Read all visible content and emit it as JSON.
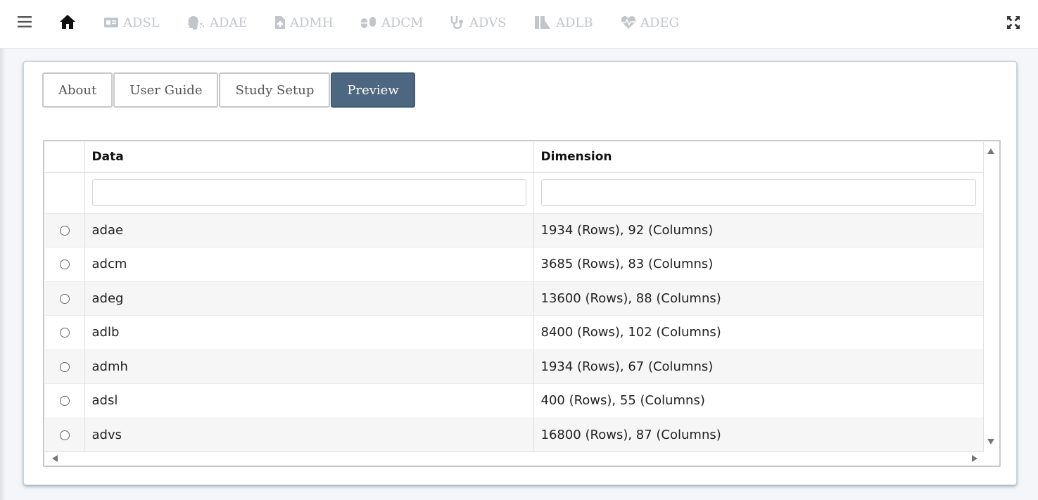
{
  "nav": {
    "items": [
      {
        "label": "ADSL",
        "icon": "id-card-icon"
      },
      {
        "label": "ADAE",
        "icon": "head-virus-icon"
      },
      {
        "label": "ADMH",
        "icon": "file-medical-icon"
      },
      {
        "label": "ADCM",
        "icon": "pills-icon"
      },
      {
        "label": "ADVS",
        "icon": "stethoscope-icon"
      },
      {
        "label": "ADLB",
        "icon": "flask-icon"
      },
      {
        "label": "ADEG",
        "icon": "heart-pulse-icon"
      }
    ]
  },
  "tabs": [
    {
      "label": "About"
    },
    {
      "label": "User Guide"
    },
    {
      "label": "Study Setup"
    },
    {
      "label": "Preview"
    }
  ],
  "active_tab": "Preview",
  "table": {
    "columns": [
      "",
      "Data",
      "Dimension"
    ],
    "rows": [
      {
        "data": "adae",
        "dimension": "1934 (Rows), 92 (Columns)"
      },
      {
        "data": "adcm",
        "dimension": "3685 (Rows), 83 (Columns)"
      },
      {
        "data": "adeg",
        "dimension": "13600 (Rows), 88 (Columns)"
      },
      {
        "data": "adlb",
        "dimension": "8400 (Rows), 102 (Columns)"
      },
      {
        "data": "admh",
        "dimension": "1934 (Rows), 67 (Columns)"
      },
      {
        "data": "adsl",
        "dimension": "400 (Rows), 55 (Columns)"
      },
      {
        "data": "advs",
        "dimension": "16800 (Rows), 87 (Columns)"
      }
    ]
  },
  "colors": {
    "active_tab_bg": "#4d6780",
    "nav_inactive": "#c2c6cb"
  }
}
